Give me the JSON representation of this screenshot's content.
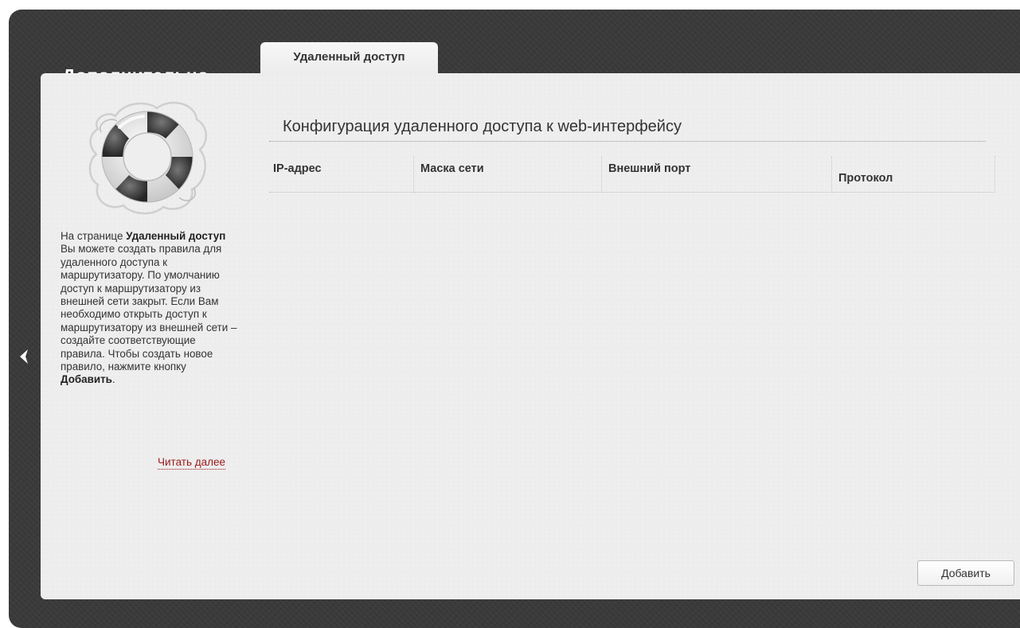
{
  "header": {
    "section_title": "Дополнительно »",
    "active_tab": "Удаленный доступ"
  },
  "sidebar": {
    "icon": "lifebuoy-icon",
    "help": {
      "t1": "На странице ",
      "b1": "Удаленный доступ",
      "t2": " Вы можете создать правила для удаленного доступа к маршрутизатору. По умолчанию доступ к маршрутизатору из внешней сети закрыт. Если Вам необходимо открыть доступ к маршрутизатору из внешней сети – создайте соответствующие правила. Чтобы создать новое правило, нажмите кнопку ",
      "b2": "Добавить",
      "t3": "."
    },
    "read_more": "Читать далее"
  },
  "main": {
    "title": "Конфигурация удаленного доступа к web-интерфейсу",
    "columns": [
      "IP-адрес",
      "Маска сети",
      "Внешний порт",
      "Протокол"
    ],
    "rows": [],
    "add_button": "Добавить"
  },
  "nav": {
    "back_icon": "chevron-left-icon"
  },
  "colors": {
    "frame": "#3a3a3a",
    "panel": "#eeeeee",
    "link": "#9a1a1a"
  }
}
